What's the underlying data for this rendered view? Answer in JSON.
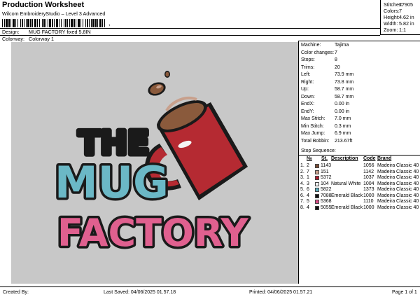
{
  "header": {
    "title": "Production Worksheet",
    "subtitle": "Wilcom EmbroideryStudio – Level 3 Advanced",
    "barcode_suffix": ",",
    "design_label": "Design:",
    "design_value": "MUG FACTORY fixed 5,8IN",
    "colorway_label": "Colorway:",
    "colorway_value": "Colorway 1"
  },
  "stats": [
    {
      "label": "Stitches:",
      "value": "27905"
    },
    {
      "label": "Colors:",
      "value": "7"
    },
    {
      "label": "Height:",
      "value": "4.62 in"
    },
    {
      "label": "Width:",
      "value": "5.82 in"
    },
    {
      "label": "Zoom:",
      "value": "1:1"
    }
  ],
  "machine_info": [
    {
      "label": "Machine:",
      "value": "Tajima"
    },
    {
      "label": "Color changes:",
      "value": "7"
    },
    {
      "label": "Stops:",
      "value": "8"
    },
    {
      "label": "Trims:",
      "value": "20"
    },
    {
      "label": "Left:",
      "value": "73.9 mm"
    },
    {
      "label": "Right:",
      "value": "73.8 mm"
    },
    {
      "label": "Up:",
      "value": "58.7 mm"
    },
    {
      "label": "Down:",
      "value": "58.7 mm"
    },
    {
      "label": "EndX:",
      "value": "0.00 in"
    },
    {
      "label": "EndY:",
      "value": "0.00 in"
    },
    {
      "label": "Max Stitch:",
      "value": "7.0 mm"
    },
    {
      "label": "Min Stitch:",
      "value": "0.3 mm"
    },
    {
      "label": "Max Jump:",
      "value": "6.9 mm"
    },
    {
      "label": "Total Bobbin:",
      "value": "213.67ft"
    }
  ],
  "stop_sequence": {
    "title": "Stop Sequence:",
    "headers": {
      "number": "№",
      "st": "St.",
      "description": "Description",
      "code": "Code",
      "brand": "Brand"
    },
    "rows": [
      {
        "stop": "1.",
        "number": "2",
        "color": "#7a4e35",
        "st": "1143",
        "description": "",
        "stitches": "1056",
        "code": "Madeira",
        "brand": "Classic 40"
      },
      {
        "stop": "2.",
        "number": "7",
        "color": "#c8a08c",
        "st": "151",
        "description": "",
        "stitches": "1142",
        "code": "Madeira",
        "brand": "Classic 40"
      },
      {
        "stop": "3.",
        "number": "1",
        "color": "#b01c2e",
        "st": "5372",
        "description": "",
        "stitches": "1037",
        "code": "Madeira",
        "brand": "Classic 40"
      },
      {
        "stop": "4.",
        "number": "3",
        "color": "#f4f4f4",
        "st": "104",
        "description": "Natural White",
        "stitches": "1004",
        "code": "Madeira",
        "brand": "Classic 40"
      },
      {
        "stop": "5.",
        "number": "6",
        "color": "#5aaebe",
        "st": "5822",
        "description": "",
        "stitches": "1373",
        "code": "Madeira",
        "brand": "Classic 40"
      },
      {
        "stop": "6.",
        "number": "4",
        "color": "#111111",
        "st": "7088",
        "description": "Emerald Black",
        "stitches": "1000",
        "code": "Madeira",
        "brand": "Classic 40"
      },
      {
        "stop": "7.",
        "number": "5",
        "color": "#d94d86",
        "st": "5368",
        "description": "",
        "stitches": "1110",
        "code": "Madeira",
        "brand": "Classic 40"
      },
      {
        "stop": "8.",
        "number": "4",
        "color": "#111111",
        "st": "5055",
        "description": "Emerald Black",
        "stitches": "1000",
        "code": "Madeira",
        "brand": "Classic 40"
      }
    ]
  },
  "design_text": {
    "line1": "THE",
    "line2": "MUG",
    "line3": "FACTORY"
  },
  "colors": {
    "canvas": "#c8c8c8",
    "mug": "#b52a32",
    "coffee": "#8a5a3c",
    "teal": "#6bb8c6",
    "pink": "#e0608f",
    "outline": "#1a1a1a"
  },
  "footer": {
    "created_by": "Created By:",
    "last_saved": "Last Saved: 04/06/2025 01.57.18",
    "printed": "Printed: 04/06/2025 01.57.21",
    "page": "Page 1 of 1"
  }
}
